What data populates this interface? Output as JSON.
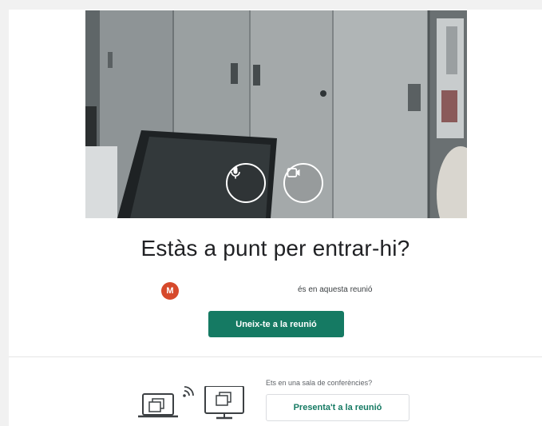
{
  "preview": {
    "mic_icon": "microphone-icon",
    "camera_icon": "video-camera-icon"
  },
  "prejoin": {
    "title": "Estàs a punt per entrar-hi?",
    "avatar_initial": "M",
    "status": "és en aquesta reunió",
    "join_label": "Uneix-te a la reunió"
  },
  "present": {
    "room_question": "Ets en una sala de conferències?",
    "button_label": "Presenta't a la reunió",
    "laptop_icon": "laptop-present-icon",
    "wifi_icon": "wireless-signal-icon",
    "monitor_icon": "monitor-present-icon"
  },
  "colors": {
    "accent": "#157a63",
    "avatar": "#d6492b",
    "background": "#f1f1f1"
  }
}
